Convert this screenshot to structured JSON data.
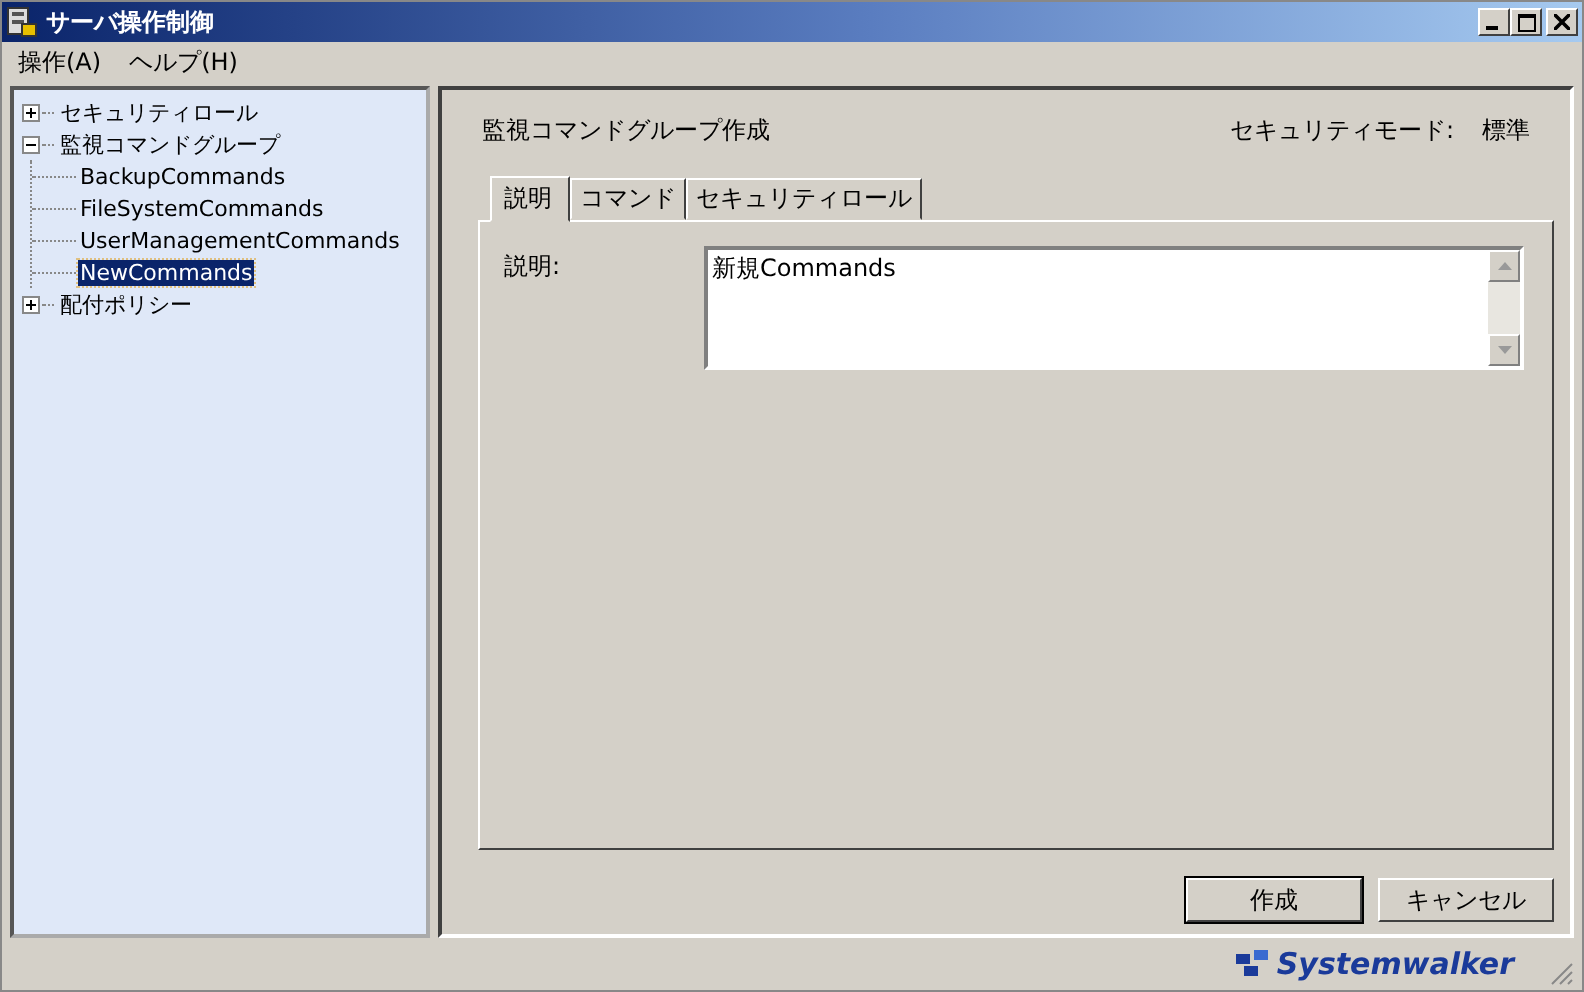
{
  "window": {
    "title": "サーバ操作制御"
  },
  "menu": [
    {
      "label": "操作(A)"
    },
    {
      "label": "ヘルプ(H)"
    }
  ],
  "tree": [
    {
      "label": "セキュリティロール",
      "expanded": false,
      "selected": false
    },
    {
      "label": "監視コマンドグループ",
      "expanded": true,
      "selected": false,
      "children": [
        {
          "label": "BackupCommands",
          "selected": false
        },
        {
          "label": "FileSystemCommands",
          "selected": false
        },
        {
          "label": "UserManagementCommands",
          "selected": false
        },
        {
          "label": "NewCommands",
          "selected": true
        }
      ]
    },
    {
      "label": "配付ポリシー",
      "expanded": false,
      "selected": false
    }
  ],
  "panel": {
    "title": "監視コマンドグループ作成",
    "security_mode_label": "セキュリティモード:",
    "security_mode_value": "標準"
  },
  "tabs": [
    {
      "label": "説明",
      "selected": true
    },
    {
      "label": "コマンド",
      "selected": false
    },
    {
      "label": "セキュリティロール",
      "selected": false
    }
  ],
  "description": {
    "label": "説明:",
    "value": "新規Commands"
  },
  "buttons": [
    {
      "label": "作成",
      "default": true
    },
    {
      "label": "キャンセル",
      "default": false
    }
  ],
  "footer": {
    "logo": "Systemwalker"
  }
}
